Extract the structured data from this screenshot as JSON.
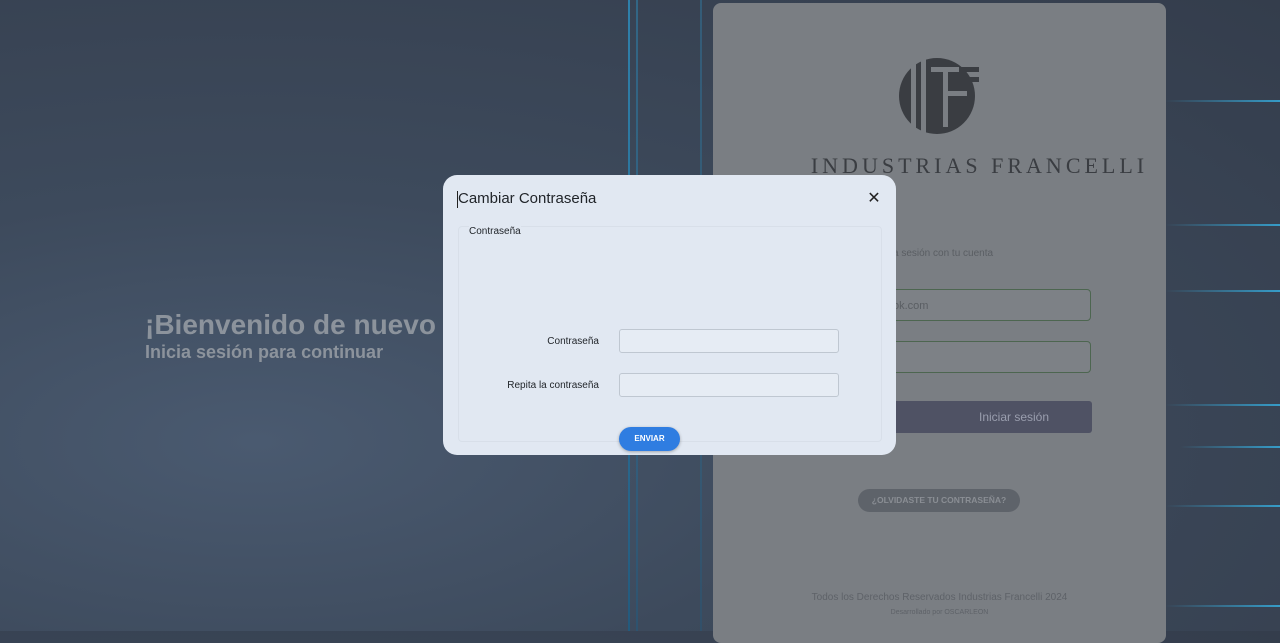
{
  "welcome": {
    "heading": "¡Bienvenido de nuevo",
    "subheading": "Inicia sesión para continuar"
  },
  "login_panel": {
    "brand": "INDUSTRIAS FRANCELLI",
    "subtitle": "a sesión con tu cuenta",
    "email_value": "ok.com",
    "password_value": "",
    "submit_label": "Iniciar sesión",
    "forgot_label": "¿OLVIDASTE TU CONTRASEÑA?",
    "copyright": "Todos los Derechos Reservados Industrias Francelli 2024",
    "developer": "Desarrollado por OSCARLEON"
  },
  "modal": {
    "title": "Cambiar Contraseña",
    "close_icon": "close-icon",
    "legend": "Contraseña",
    "password_label": "Contraseña",
    "password_value": "",
    "repeat_label": "Repita la contraseña",
    "repeat_value": "",
    "submit_label": "ENVIAR"
  },
  "colors": {
    "accent": "#2f7de1",
    "modal_bg": "#e1e8f2",
    "line_glow": "#35b3e6"
  }
}
